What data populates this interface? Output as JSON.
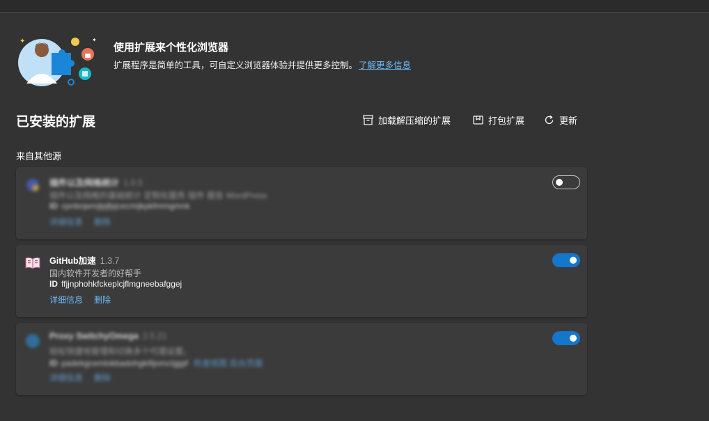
{
  "hero": {
    "title": "使用扩展来个性化浏览器",
    "desc": "扩展程序是简单的工具，可自定义浏览器体验并提供更多控制。",
    "learn_more": "了解更多信息"
  },
  "installed": {
    "title": "已安装的扩展",
    "actions": {
      "load_unpacked": "加载解压缩的扩展",
      "pack": "打包扩展",
      "update": "更新"
    }
  },
  "source_title": "来自其他源",
  "extensions": [
    {
      "name": "插件以及网格统计",
      "version": "1.0.5",
      "desc": "插件以及网格的基础统计   定制化服务   插件   报告   WordPress",
      "id_label": "ID",
      "id": "cpnbnjemjlpjfpjcecmijkpkfmmgmnk",
      "details": "详细信息",
      "remove": "删除",
      "enabled": false,
      "icon": "generic-extension-icon"
    },
    {
      "name": "GitHub加速",
      "version": "1.3.7",
      "desc": "国内软件开发者的好帮手",
      "id_label": "ID",
      "id": "ffjjnphohkfckeplcjflmgneebafggej",
      "details": "详细信息",
      "remove": "删除",
      "enabled": true,
      "icon": "book-icon"
    },
    {
      "name": "Proxy SwitchyOmega",
      "version": "2.5.21",
      "desc": "轻松快捷地管理和切换多个代理设置。",
      "id_label": "ID",
      "id": "padekgcemlokbadohgkifijomclgjgif",
      "extra": "检查视图 后台页面",
      "details": "详细信息",
      "remove": "删除",
      "enabled": true,
      "icon": "proxy-icon"
    }
  ]
}
